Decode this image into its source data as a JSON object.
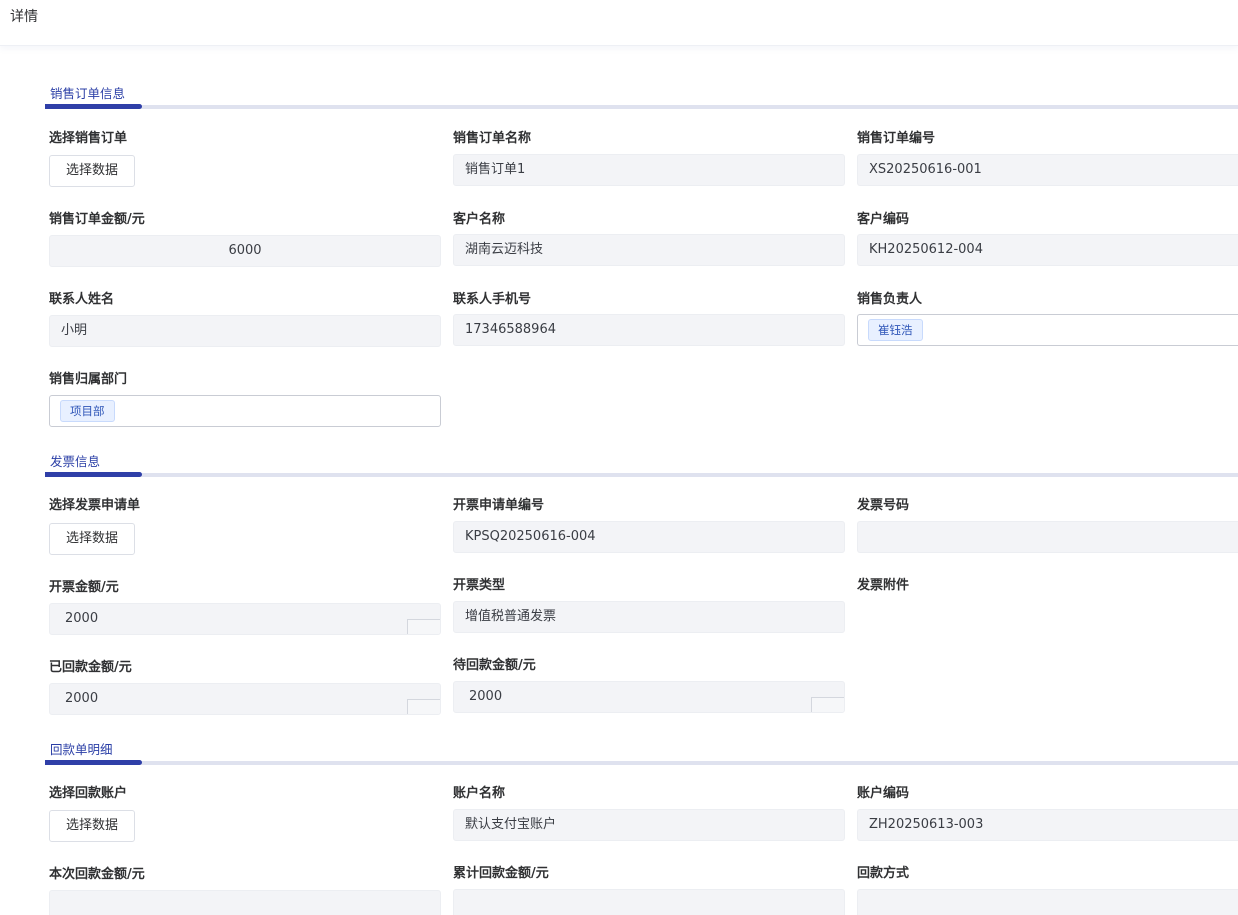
{
  "page": {
    "title": "详情"
  },
  "sections": {
    "sales": "销售订单信息",
    "invoice": "发票信息",
    "payment": "回款单明细"
  },
  "sales": {
    "select_order_label": "选择销售订单",
    "select_button": "选择数据",
    "order_name_label": "销售订单名称",
    "order_name": "销售订单1",
    "order_no_label": "销售订单编号",
    "order_no": "XS20250616-001",
    "amount_label": "销售订单金额/元",
    "amount": "6000",
    "customer_name_label": "客户名称",
    "customer_name": "湖南云迈科技",
    "customer_code_label": "客户编码",
    "customer_code": "KH20250612-004",
    "contact_name_label": "联系人姓名",
    "contact_name": "小明",
    "contact_phone_label": "联系人手机号",
    "contact_phone": "17346588964",
    "owner_label": "销售负责人",
    "owner_tag": "崔钰浩",
    "dept_label": "销售归属部门",
    "dept_tag": "项目部"
  },
  "invoice": {
    "select_request_label": "选择发票申请单",
    "select_button": "选择数据",
    "request_no_label": "开票申请单编号",
    "request_no": "KPSQ20250616-004",
    "invoice_no_label": "发票号码",
    "invoice_no": "",
    "amount_label": "开票金额/元",
    "amount": "2000",
    "type_label": "开票类型",
    "type": "增值税普通发票",
    "attachment_label": "发票附件",
    "paid_label": "已回款金额/元",
    "paid": "2000",
    "pending_label": "待回款金额/元",
    "pending": "2000"
  },
  "payment": {
    "select_account_label": "选择回款账户",
    "select_button": "选择数据",
    "account_name_label": "账户名称",
    "account_name": "默认支付宝账户",
    "account_code_label": "账户编码",
    "account_code": "ZH20250613-003",
    "this_amount_label": "本次回款金额/元",
    "total_amount_label": "累计回款金额/元",
    "method_label": "回款方式"
  }
}
